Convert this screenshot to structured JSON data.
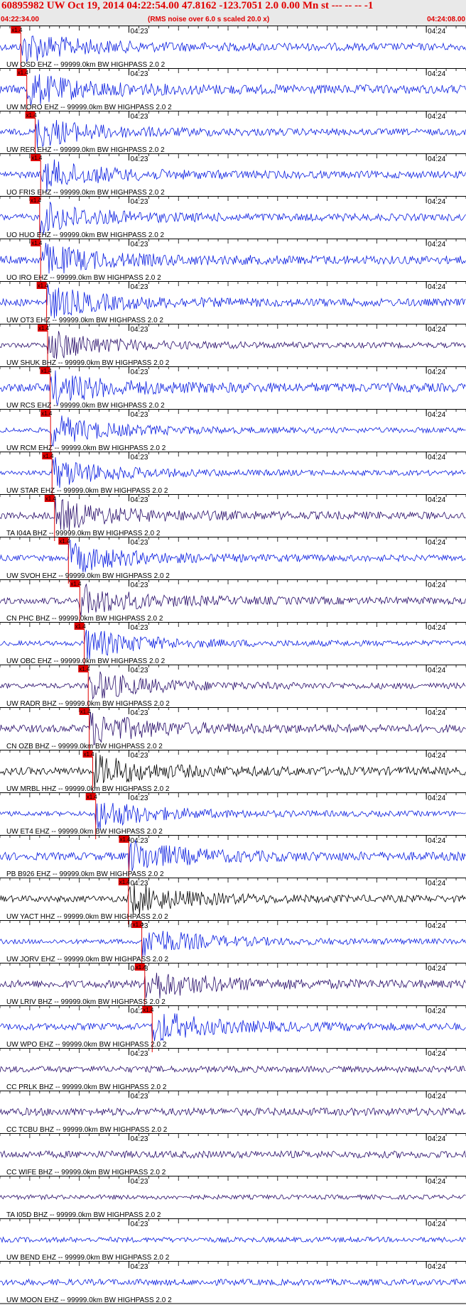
{
  "header": {
    "title": "60895982 UW Oct 19, 2014 04:22:54.00   47.8162 -123.7051  2.0 0.00 Mn st --- -- --   -1",
    "start_time": "04:22:34.00",
    "note": "(RMS noise over 6.0 s scaled 20.0 x)",
    "end_time": "04:24:08.00"
  },
  "chart_data": {
    "type": "line",
    "time_start": "04:22:34.00",
    "time_end": "04:24:08.00",
    "tick_labels": [
      "04:23",
      "04:24"
    ],
    "pick_label": "x1.4",
    "colors": {
      "blue": "#0b1ee0",
      "purple": "#2a0f6b",
      "black": "#000000",
      "pick": "#e00000"
    },
    "traces": [
      {
        "label": "UW OSD EHZ -- 99999.0km BW  HIGHPASS  2.0  2",
        "color": "blue",
        "pick_s": 4.2
      },
      {
        "label": "UW MORO EHZ -- 99999.0km BW  HIGHPASS  2.0  2",
        "color": "blue",
        "pick_s": 5.4
      },
      {
        "label": "UW RER EHZ -- 99999.0km BW  HIGHPASS  2.0  2",
        "color": "blue",
        "pick_s": 7.1
      },
      {
        "label": "UO FRIS EHZ -- 99999.0km BW  HIGHPASS  2.0  2",
        "color": "blue",
        "pick_s": 8.2
      },
      {
        "label": "UO HUO EHZ -- 99999.0km BW  HIGHPASS  2.0  2",
        "color": "blue",
        "pick_s": 8.0
      },
      {
        "label": "UO IRO EHZ -- 99999.0km BW  HIGHPASS  2.0  2",
        "color": "blue",
        "pick_s": 8.2
      },
      {
        "label": "UW OT3 EHZ -- 99999.0km BW  HIGHPASS  2.0  2",
        "color": "blue",
        "pick_s": 9.4
      },
      {
        "label": "UW SHUK BHZ -- 99999.0km BW  HIGHPASS  2.0  2",
        "color": "purple",
        "pick_s": 9.6
      },
      {
        "label": "UW RCS EHZ -- 99999.0km BW  HIGHPASS  2.0  2",
        "color": "blue",
        "pick_s": 10.1
      },
      {
        "label": "UW RCM EHZ -- 99999.0km BW  HIGHPASS  2.0  2",
        "color": "blue",
        "pick_s": 10.2
      },
      {
        "label": "UW STAR EHZ -- 99999.0km BW  HIGHPASS  2.0  2",
        "color": "blue",
        "pick_s": 10.5
      },
      {
        "label": "TA I04A BHZ -- 99999.0km BW  HIGHPASS  2.0  2",
        "color": "purple",
        "pick_s": 11.0
      },
      {
        "label": "UW SVOH EHZ -- 99999.0km BW  HIGHPASS  2.0  2",
        "color": "blue",
        "pick_s": 13.8
      },
      {
        "label": "CN PHC BHZ -- 99999.0km BW  HIGHPASS  2.0  2",
        "color": "purple",
        "pick_s": 16.1
      },
      {
        "label": "UW OBC EHZ -- 99999.0km BW  HIGHPASS  2.0  2",
        "color": "blue",
        "pick_s": 17.0
      },
      {
        "label": "UW RADR BHZ -- 99999.0km BW  HIGHPASS  2.0  2",
        "color": "purple",
        "pick_s": 17.8
      },
      {
        "label": "CN OZB BHZ -- 99999.0km BW  HIGHPASS  2.0  2",
        "color": "purple",
        "pick_s": 18.0
      },
      {
        "label": "UW MRBL HHZ -- 99999.0km BW  HIGHPASS  2.0  2",
        "color": "black",
        "pick_s": 18.7
      },
      {
        "label": "UW ET4 EHZ -- 99999.0km BW  HIGHPASS  2.0  2",
        "color": "blue",
        "pick_s": 19.3
      },
      {
        "label": "PB B926 EHZ -- 99999.0km BW  HIGHPASS  2.0  2",
        "color": "blue",
        "pick_s": 26.0
      },
      {
        "label": "UW YACT HHZ -- 99999.0km BW  HIGHPASS  2.0  2",
        "color": "black",
        "pick_s": 25.9
      },
      {
        "label": "UW JORV EHZ -- 99999.0km BW  HIGHPASS  2.0  2",
        "color": "blue",
        "pick_s": 28.6
      },
      {
        "label": "UW LRIV BHZ -- 99999.0km BW  HIGHPASS  2.0  2",
        "color": "purple",
        "pick_s": 29.2
      },
      {
        "label": "UW WPO EHZ -- 99999.0km BW  HIGHPASS  2.0  2",
        "color": "blue",
        "pick_s": 30.7
      },
      {
        "label": "CC PRLK BHZ -- 99999.0km BW  HIGHPASS  2.0  2",
        "color": "purple",
        "pick_s": null
      },
      {
        "label": "CC TCBU BHZ -- 99999.0km BW  HIGHPASS  2.0  2",
        "color": "purple",
        "pick_s": null
      },
      {
        "label": "CC WIFE BHZ -- 99999.0km BW  HIGHPASS  2.0  2",
        "color": "purple",
        "pick_s": null
      },
      {
        "label": "TA I05D BHZ -- 99999.0km BW  HIGHPASS  2.0  2",
        "color": "purple",
        "pick_s": null
      },
      {
        "label": "UW BEND EHZ -- 99999.0km BW  HIGHPASS  2.0  2",
        "color": "blue",
        "pick_s": null
      },
      {
        "label": "UW MOON EHZ -- 99999.0km BW  HIGHPASS  2.0  2",
        "color": "blue",
        "pick_s": null
      }
    ]
  }
}
